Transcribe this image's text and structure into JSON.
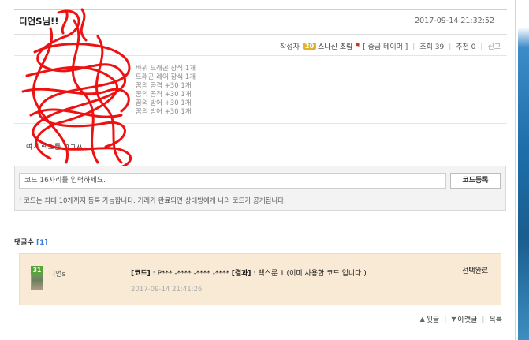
{
  "post": {
    "title": "디언S님!!",
    "date": "2017-09-14 21:32:52"
  },
  "meta": {
    "author_label": "작성자",
    "level": "20",
    "author_name": "스나신 초림",
    "grade": "[ 중급 테이머 ]",
    "views_label": "조회 39",
    "recommend_label": "추천 0",
    "report_label": "신고",
    "colors": {
      "level_badge": "#e1b12c"
    }
  },
  "items": [
    "바위 드래곤 장식 1개",
    "드래곤 레어 장식 1개",
    "꿈의 공격 +30 1개",
    "꿈의 공격 +30 1개",
    "꿈의 방어 +30 1개",
    "꿈의 방어 +30 1개"
  ],
  "body_text": "여기 렉스룸 ㄱㄱㅆ",
  "code": {
    "placeholder": "코드 16자리를 입력하세요.",
    "button_label": "코드등록",
    "note": "! 코드는 최대 10개까지 등록 가능합니다. 거래가 완료되면 상대방에게 나의 코드가 공개됩니다."
  },
  "comments": {
    "count_label": "댓글수",
    "count": "[1]",
    "list": [
      {
        "level": "31",
        "user": "디언s",
        "code_label": "[코드]",
        "code_value": ": P*** -**** -**** -****",
        "result_label": "[결과]",
        "result_value": ": 렉스룬 1 (이미 사용한 코드 입니다.)",
        "time": "2017-09-14 21:41:26",
        "status": "선택완료"
      }
    ]
  },
  "nav": {
    "prev": "윗글",
    "next": "아랫글",
    "list": "목록"
  },
  "icons": [
    "chevron-up-icon",
    "chevron-down-icon",
    "pink-tag-icon"
  ]
}
